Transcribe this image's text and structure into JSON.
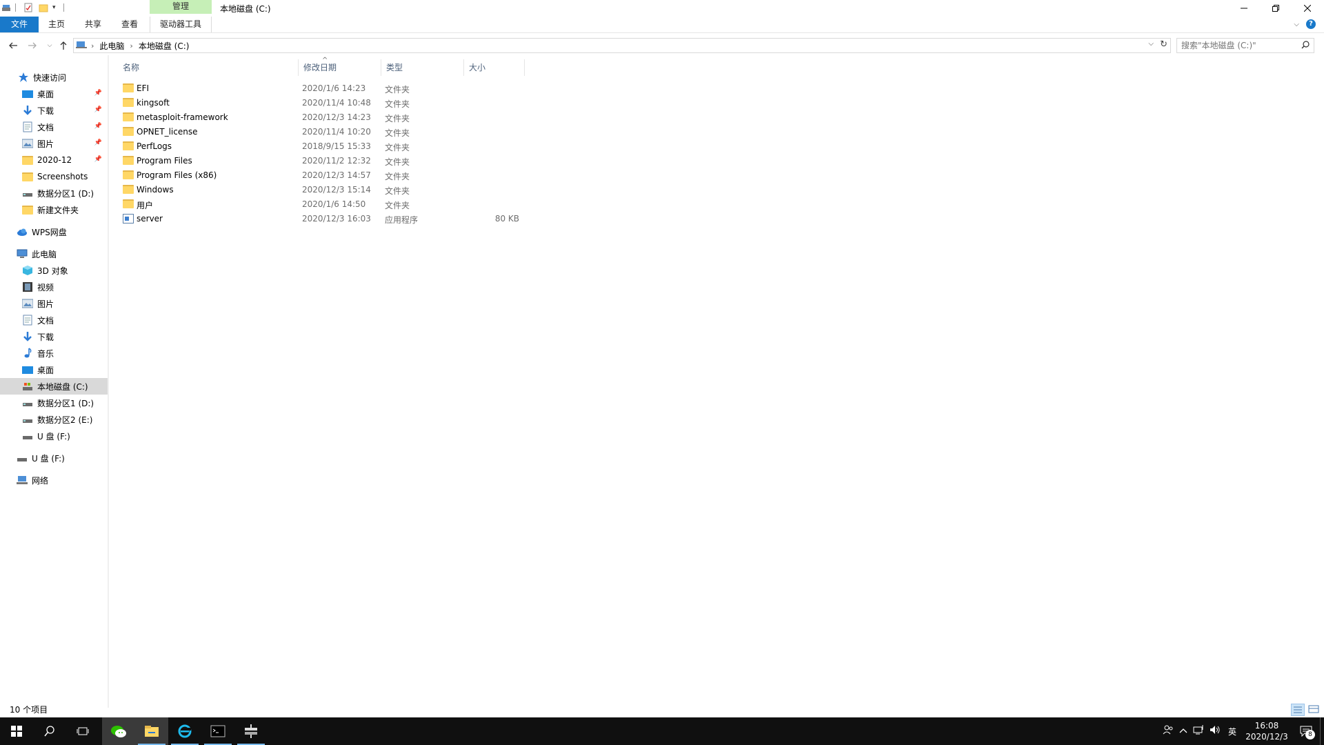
{
  "window": {
    "title": "本地磁盘 (C:)",
    "contextual_tab_header": "管理"
  },
  "ribbon": {
    "tabs": [
      "文件",
      "主页",
      "共享",
      "查看",
      "驱动器工具"
    ]
  },
  "address": {
    "crumbs": [
      "此电脑",
      "本地磁盘 (C:)"
    ],
    "search_placeholder": "搜索\"本地磁盘 (C:)\""
  },
  "navpane": {
    "quick_access": "快速访问",
    "quick_items": [
      {
        "label": "桌面",
        "pinned": true
      },
      {
        "label": "下载",
        "pinned": true
      },
      {
        "label": "文档",
        "pinned": true
      },
      {
        "label": "图片",
        "pinned": true
      },
      {
        "label": "2020-12",
        "pinned": true
      },
      {
        "label": "Screenshots",
        "pinned": false
      },
      {
        "label": "数据分区1 (D:)",
        "pinned": false
      },
      {
        "label": "新建文件夹",
        "pinned": false
      }
    ],
    "wps": "WPS网盘",
    "this_pc": "此电脑",
    "pc_items": [
      "3D 对象",
      "视频",
      "图片",
      "文档",
      "下载",
      "音乐",
      "桌面",
      "本地磁盘 (C:)",
      "数据分区1 (D:)",
      "数据分区2 (E:)",
      "U 盘 (F:)"
    ],
    "usb": "U 盘 (F:)",
    "network": "网络"
  },
  "columns": {
    "name": "名称",
    "date": "修改日期",
    "type": "类型",
    "size": "大小"
  },
  "files": [
    {
      "name": "EFI",
      "date": "2020/1/6 14:23",
      "type": "文件夹",
      "size": "",
      "kind": "folder"
    },
    {
      "name": "kingsoft",
      "date": "2020/11/4 10:48",
      "type": "文件夹",
      "size": "",
      "kind": "folder"
    },
    {
      "name": "metasploit-framework",
      "date": "2020/12/3 14:23",
      "type": "文件夹",
      "size": "",
      "kind": "folder"
    },
    {
      "name": "OPNET_license",
      "date": "2020/11/4 10:20",
      "type": "文件夹",
      "size": "",
      "kind": "folder"
    },
    {
      "name": "PerfLogs",
      "date": "2018/9/15 15:33",
      "type": "文件夹",
      "size": "",
      "kind": "folder"
    },
    {
      "name": "Program Files",
      "date": "2020/11/2 12:32",
      "type": "文件夹",
      "size": "",
      "kind": "folder"
    },
    {
      "name": "Program Files (x86)",
      "date": "2020/12/3 14:57",
      "type": "文件夹",
      "size": "",
      "kind": "folder"
    },
    {
      "name": "Windows",
      "date": "2020/12/3 15:14",
      "type": "文件夹",
      "size": "",
      "kind": "folder"
    },
    {
      "name": "用户",
      "date": "2020/1/6 14:50",
      "type": "文件夹",
      "size": "",
      "kind": "folder"
    },
    {
      "name": "server",
      "date": "2020/12/3 16:03",
      "type": "应用程序",
      "size": "80 KB",
      "kind": "exe"
    }
  ],
  "status": {
    "count": "10 个项目"
  },
  "taskbar": {
    "ime": "英",
    "time": "16:08",
    "date": "2020/12/3",
    "notification_count": "8"
  },
  "colors": {
    "accent": "#1979ca",
    "manage_tab": "#c6efb7",
    "folder": "#ffd766",
    "selected": "#d9d9d9",
    "taskbar": "#101010"
  }
}
